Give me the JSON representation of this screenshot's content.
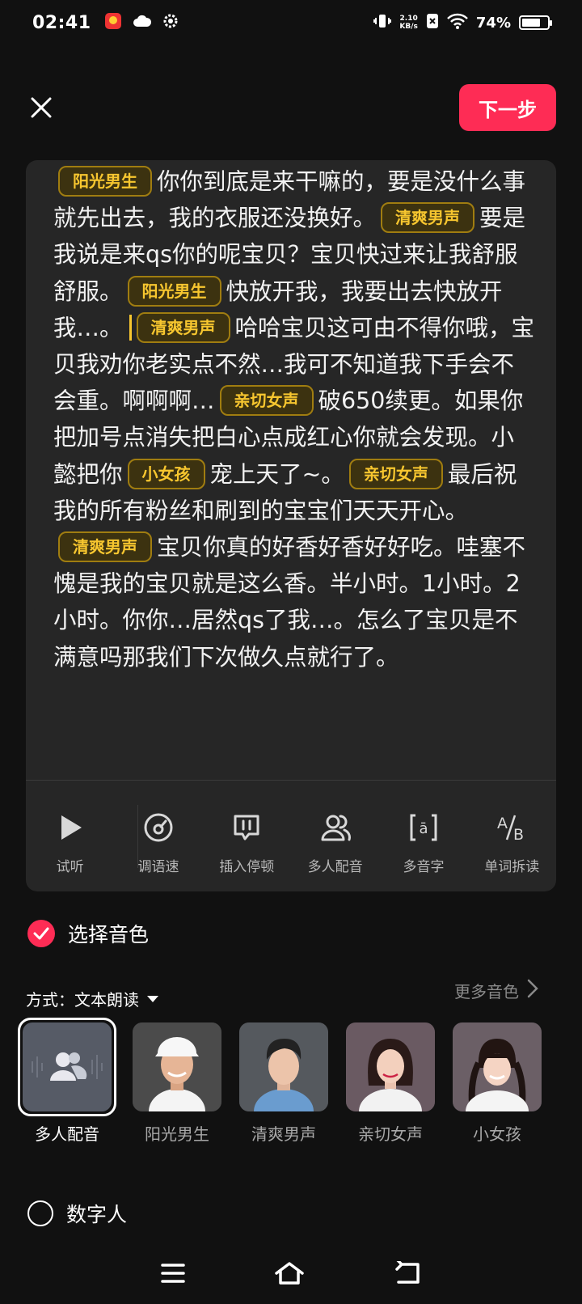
{
  "status_bar": {
    "time": "02:41",
    "net_speed_top": "2.10",
    "net_speed_bottom": "KB/s",
    "battery": "74%",
    "battery_level": 0.74
  },
  "header": {
    "next_label": "下一步"
  },
  "editor": {
    "segments": [
      {
        "tag": "阳光男生",
        "text": "你你到底是来干嘛的，要是没什么事就先出去，我的衣服还没换好。"
      },
      {
        "tag": "清爽男声",
        "text": "要是我说是来qs你的呢宝贝？宝贝快过来让我舒服舒服。"
      },
      {
        "tag": "阳光男生",
        "text": "快放开我，我要出去快放开我…。"
      },
      {
        "tag": "清爽男声",
        "text": "哈哈宝贝这可由不得你哦，宝贝我劝你老实点不然…我可不知道我下手会不会重。啊啊啊…"
      },
      {
        "tag": "亲切女声",
        "text": "破650续更。如果你把加号点消失把白心点成红心你就会发现。小懿把你"
      },
      {
        "tag": "小女孩",
        "text": "宠上天了~。"
      },
      {
        "tag": "亲切女声",
        "text": "最后祝我的所有粉丝和刷到的宝宝们天天开心。"
      },
      {
        "tag": "清爽男声",
        "text": "宝贝你真的好香好香好好吃。哇塞不愧是我的宝贝就是这么香。半小时。1小时。2小时。你你…居然qs了我…。怎么了宝贝是不满意吗那我们下次做久点就行了。"
      }
    ]
  },
  "toolbar": {
    "items": [
      {
        "label": "试听",
        "icon": "play-icon"
      },
      {
        "label": "调语速",
        "icon": "speed-dial-icon"
      },
      {
        "label": "插入停顿",
        "icon": "pause-insert-icon"
      },
      {
        "label": "多人配音",
        "icon": "multi-person-icon"
      },
      {
        "label": "多音字",
        "icon": "polyphone-icon"
      },
      {
        "label": "单词拆读",
        "icon": "word-split-icon"
      }
    ]
  },
  "voice_section": {
    "title": "选择音色",
    "mode_label": "方式：文本朗读",
    "more_label": "更多音色",
    "voices": [
      {
        "label": "多人配音",
        "selected": true
      },
      {
        "label": "阳光男生",
        "selected": false
      },
      {
        "label": "清爽男声",
        "selected": false
      },
      {
        "label": "亲切女声",
        "selected": false
      },
      {
        "label": "小女孩",
        "selected": false
      }
    ]
  },
  "digital_section": {
    "title": "数字人"
  },
  "colors": {
    "accent": "#fe2c55",
    "tag_text": "#f7c62f",
    "background": "#111111",
    "panel": "#262626"
  }
}
